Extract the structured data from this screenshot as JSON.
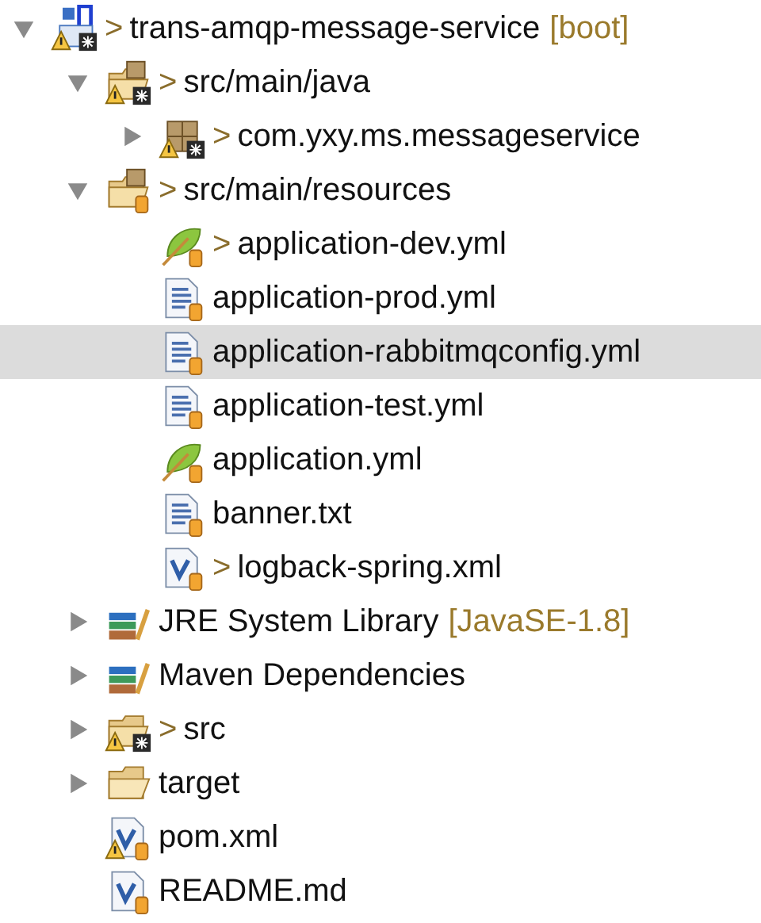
{
  "tree": [
    {
      "label": "trans-amqp-message-service",
      "prefix": ">",
      "suffix": "[boot]",
      "kind": "project",
      "warning": true,
      "expanded": true,
      "selected": false,
      "children": [
        {
          "label": "src/main/java",
          "prefix": ">",
          "kind": "source-folder",
          "warning": true,
          "expanded": true,
          "selected": false,
          "children": [
            {
              "label": "com.yxy.ms.messageservice",
              "prefix": ">",
              "kind": "package",
              "warning": true,
              "expanded": false,
              "selected": false
            }
          ]
        },
        {
          "label": "src/main/resources",
          "prefix": ">",
          "kind": "resource-folder",
          "warning": false,
          "expanded": true,
          "selected": false,
          "children": [
            {
              "label": "application-dev.yml",
              "prefix": ">",
              "kind": "spring-file",
              "warning": false,
              "selected": false
            },
            {
              "label": "application-prod.yml",
              "kind": "text-file",
              "warning": false,
              "selected": false
            },
            {
              "label": "application-rabbitmqconfig.yml",
              "kind": "text-file",
              "warning": false,
              "selected": true
            },
            {
              "label": "application-test.yml",
              "kind": "text-file",
              "warning": false,
              "selected": false
            },
            {
              "label": "application.yml",
              "kind": "spring-file",
              "warning": false,
              "selected": false
            },
            {
              "label": "banner.txt",
              "kind": "text-file",
              "warning": false,
              "selected": false
            },
            {
              "label": "logback-spring.xml",
              "prefix": ">",
              "kind": "xml-file",
              "warning": false,
              "selected": false
            }
          ]
        },
        {
          "label": "JRE System Library",
          "suffix": "[JavaSE-1.8]",
          "kind": "library",
          "warning": false,
          "expanded": false,
          "selected": false
        },
        {
          "label": "Maven Dependencies",
          "kind": "library",
          "warning": false,
          "expanded": false,
          "selected": false
        },
        {
          "label": "src",
          "prefix": ">",
          "kind": "git-folder",
          "warning": true,
          "expanded": false,
          "selected": false
        },
        {
          "label": "target",
          "kind": "folder",
          "warning": false,
          "expanded": false,
          "selected": false
        },
        {
          "label": "pom.xml",
          "kind": "maven-file",
          "warning": true,
          "selected": false
        },
        {
          "label": "README.md",
          "kind": "maven-file",
          "warning": false,
          "selected": false
        }
      ]
    }
  ]
}
